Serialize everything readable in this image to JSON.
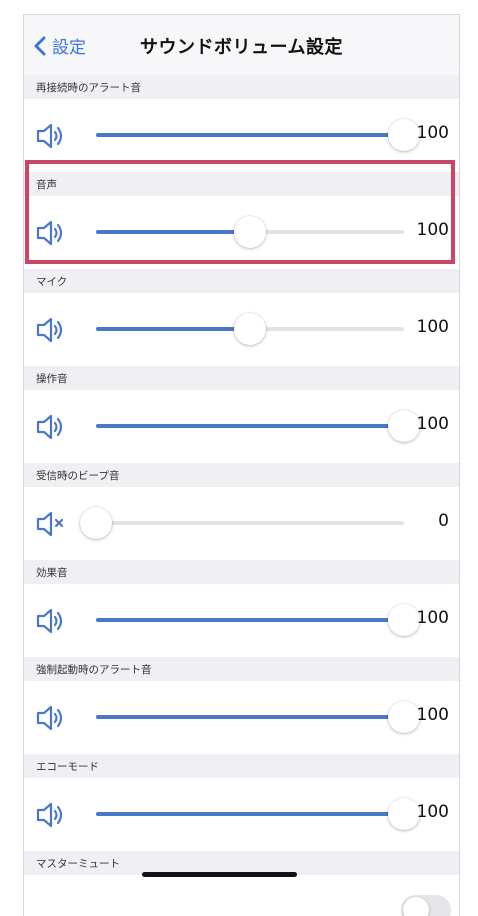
{
  "nav": {
    "back_label": "設定",
    "title": "サウンドボリューム設定"
  },
  "sections": [
    {
      "header": "再接続時のアラート音",
      "value": "100",
      "level": 1.0,
      "muted": false
    },
    {
      "header": "音声",
      "value": "100",
      "level": 0.5,
      "muted": false
    },
    {
      "header": "マイク",
      "value": "100",
      "level": 0.5,
      "muted": false
    },
    {
      "header": "操作音",
      "value": "100",
      "level": 1.0,
      "muted": false
    },
    {
      "header": "受信時のビープ音",
      "value": "0",
      "level": 0.0,
      "muted": true
    },
    {
      "header": "効果音",
      "value": "100",
      "level": 1.0,
      "muted": false
    },
    {
      "header": "強制起動時のアラート音",
      "value": "100",
      "level": 1.0,
      "muted": false
    },
    {
      "header": "エコーモード",
      "value": "100",
      "level": 1.0,
      "muted": false
    }
  ],
  "master_mute": {
    "header": "マスターミュート",
    "on": false
  },
  "colors": {
    "accent": "#4a78c9",
    "highlight": "#cc4466",
    "link": "#3a74e0"
  },
  "icons": {
    "back": "chevron-left-icon",
    "speaker": "speaker-icon",
    "speaker_muted": "speaker-muted-icon"
  }
}
